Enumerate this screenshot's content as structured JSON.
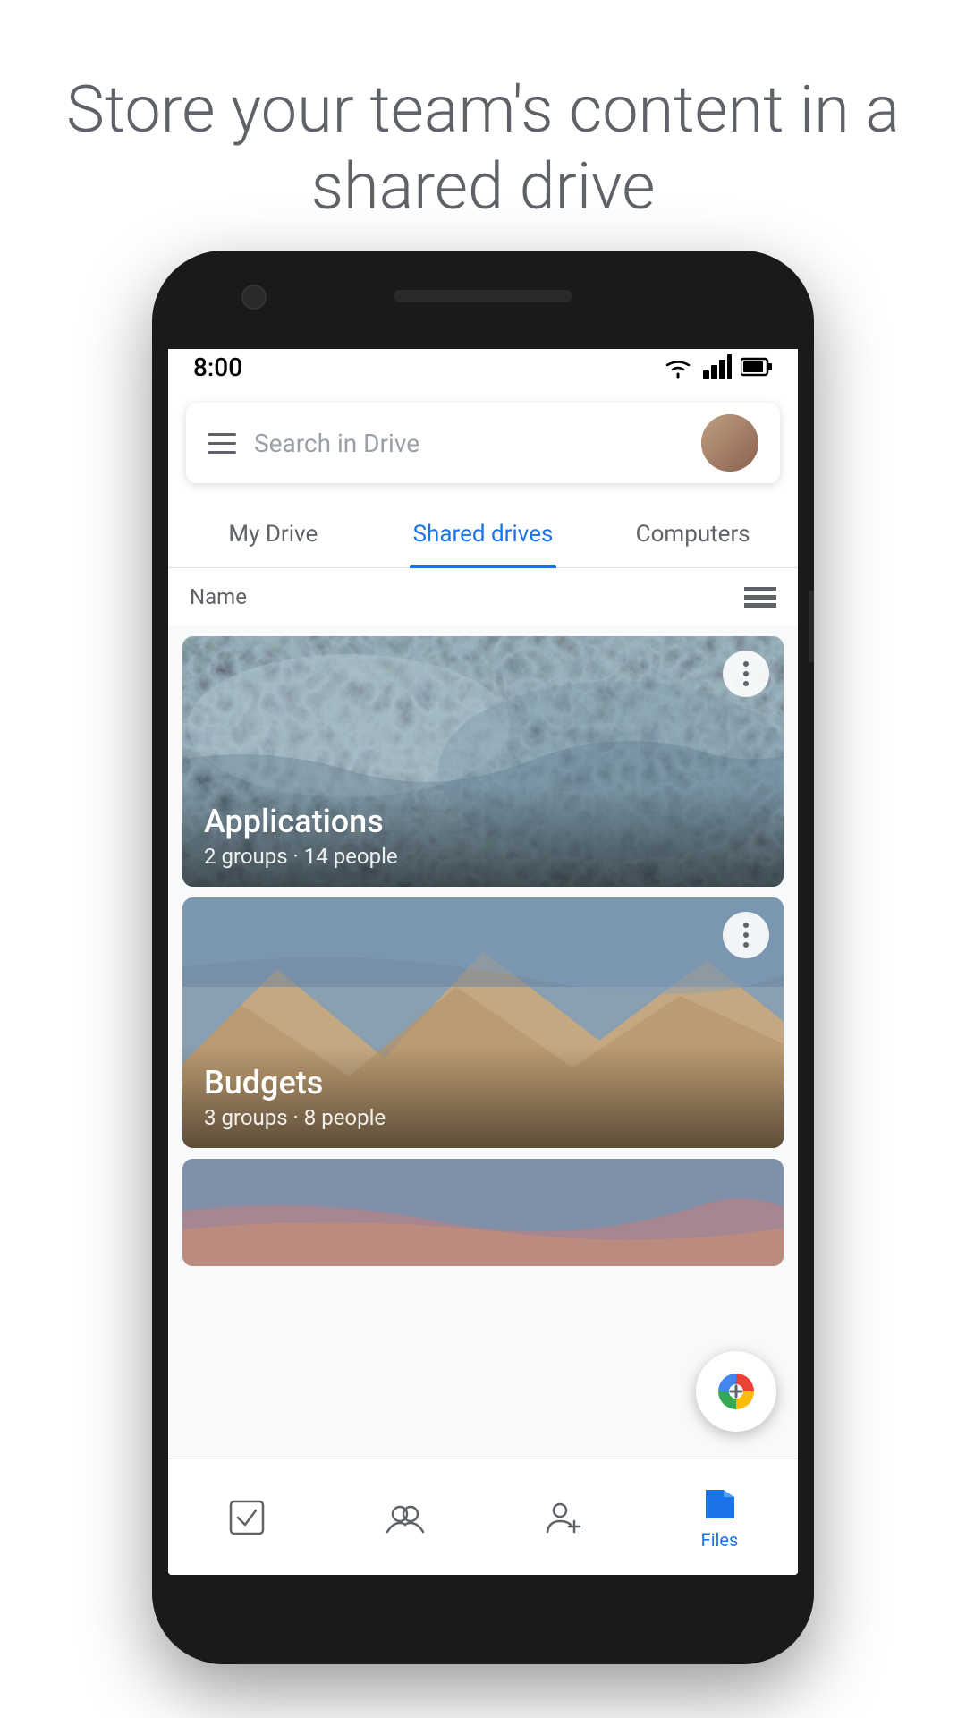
{
  "hero": {
    "text": "Store your team's content in a shared drive"
  },
  "phone": {
    "status_bar": {
      "time": "8:00"
    },
    "search_bar": {
      "placeholder": "Search in Drive"
    },
    "tabs": [
      {
        "id": "my-drive",
        "label": "My Drive",
        "active": false
      },
      {
        "id": "shared-drives",
        "label": "Shared drives",
        "active": true
      },
      {
        "id": "computers",
        "label": "Computers",
        "active": false
      }
    ],
    "sort_label": "Name",
    "drives": [
      {
        "id": "applications",
        "title": "Applications",
        "subtitle": "2 groups · 14 people",
        "bg": "water"
      },
      {
        "id": "budgets",
        "title": "Budgets",
        "subtitle": "3 groups · 8 people",
        "bg": "mountains"
      },
      {
        "id": "third",
        "title": "",
        "subtitle": "",
        "bg": "sky"
      }
    ],
    "fab_label": "+",
    "bottom_nav": [
      {
        "id": "priority",
        "label": ""
      },
      {
        "id": "activity",
        "label": ""
      },
      {
        "id": "shared",
        "label": ""
      },
      {
        "id": "files",
        "label": "Files"
      }
    ]
  }
}
